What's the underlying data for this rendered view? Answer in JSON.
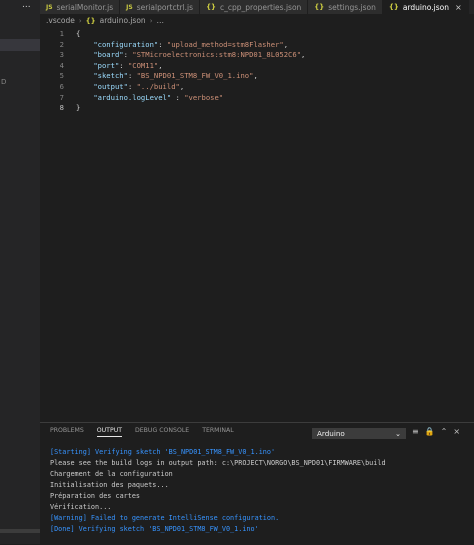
{
  "sidebar": {
    "overflow": "...",
    "fragment": "D"
  },
  "tabs": [
    {
      "icon": "JS",
      "label": "serialMonitor.js",
      "active": false
    },
    {
      "icon": "JS",
      "label": "serialportctrl.js",
      "active": false
    },
    {
      "icon": "{}",
      "label": "c_cpp_properties.json",
      "active": false
    },
    {
      "icon": "{}",
      "label": "settings.json",
      "active": false
    },
    {
      "icon": "{}",
      "label": "arduino.json",
      "active": true
    }
  ],
  "tab_close": "×",
  "breadcrumb": {
    "folder": ".vscode",
    "sep": "›",
    "file_icon": "{}",
    "file": "arduino.json",
    "tail": "…"
  },
  "editor": {
    "lines": [
      {
        "n": "1",
        "parts": [
          [
            "p",
            "{"
          ]
        ]
      },
      {
        "n": "2",
        "parts": [
          [
            "p",
            "    "
          ],
          [
            "k",
            "\"configuration\""
          ],
          [
            "p",
            ": "
          ],
          [
            "s",
            "\"upload_method=stm8Flasher\""
          ],
          [
            "p",
            ","
          ]
        ]
      },
      {
        "n": "3",
        "parts": [
          [
            "p",
            "    "
          ],
          [
            "k",
            "\"board\""
          ],
          [
            "p",
            ": "
          ],
          [
            "s",
            "\"STMicroelectronics:stm8:NPD01_8L052C6\""
          ],
          [
            "p",
            ","
          ]
        ]
      },
      {
        "n": "4",
        "parts": [
          [
            "p",
            "    "
          ],
          [
            "k",
            "\"port\""
          ],
          [
            "p",
            ": "
          ],
          [
            "s",
            "\"COM11\""
          ],
          [
            "p",
            ","
          ]
        ]
      },
      {
        "n": "5",
        "parts": [
          [
            "p",
            "    "
          ],
          [
            "k",
            "\"sketch\""
          ],
          [
            "p",
            ": "
          ],
          [
            "s",
            "\"BS_NPD01_STM8_FW_V0_1.ino\""
          ],
          [
            "p",
            ","
          ]
        ]
      },
      {
        "n": "6",
        "parts": [
          [
            "p",
            "    "
          ],
          [
            "k",
            "\"output\""
          ],
          [
            "p",
            ": "
          ],
          [
            "s",
            "\"../build\""
          ],
          [
            "p",
            ","
          ]
        ]
      },
      {
        "n": "7",
        "parts": [
          [
            "p",
            "    "
          ],
          [
            "k",
            "\"arduino.logLevel\""
          ],
          [
            "p",
            " : "
          ],
          [
            "s",
            "\"verbose\""
          ]
        ]
      },
      {
        "n": "8",
        "parts": [
          [
            "p",
            "}"
          ]
        ]
      }
    ]
  },
  "panel": {
    "tabs": [
      {
        "label": "PROBLEMS",
        "active": false
      },
      {
        "label": "OUTPUT",
        "active": true
      },
      {
        "label": "DEBUG CONSOLE",
        "active": false
      },
      {
        "label": "TERMINAL",
        "active": false
      }
    ],
    "select_value": "Arduino",
    "output": [
      {
        "text": "[Starting] Verifying sketch 'BS_NPD01_STM8_FW_V0_1.ino'",
        "color": "blue"
      },
      {
        "text": "Please see the build logs in output path: c:\\PROJECT\\NORGO\\BS_NPD01\\FIRMWARE\\build",
        "color": "plain"
      },
      {
        "text": "Chargement de la configuration",
        "color": "plain"
      },
      {
        "text": "Initialisation des paquets...",
        "color": "plain"
      },
      {
        "text": "Préparation des cartes",
        "color": "plain"
      },
      {
        "text": "Vérification...",
        "color": "plain"
      },
      {
        "text": "[Warning] Failed to generate IntelliSense configuration.",
        "color": "blue"
      },
      {
        "text": "[Done] Verifying sketch 'BS_NPD01_STM8_FW_V0_1.ino'",
        "color": "blue"
      }
    ]
  },
  "colors": {
    "background": "#1e1e1e",
    "key": "#9cdcfe",
    "string": "#ce9178",
    "info": "#3794ff"
  }
}
